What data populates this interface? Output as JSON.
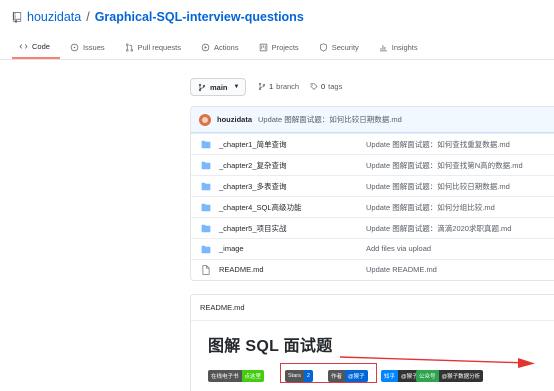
{
  "repo": {
    "owner": "houzidata",
    "separator": "/",
    "name": "Graphical-SQL-interview-questions"
  },
  "tabs": [
    {
      "label": "Code",
      "icon": "code-icon",
      "active": true
    },
    {
      "label": "Issues",
      "icon": "issue-icon",
      "active": false
    },
    {
      "label": "Pull requests",
      "icon": "pull-request-icon",
      "active": false
    },
    {
      "label": "Actions",
      "icon": "play-icon",
      "active": false
    },
    {
      "label": "Projects",
      "icon": "project-icon",
      "active": false
    },
    {
      "label": "Security",
      "icon": "shield-icon",
      "active": false
    },
    {
      "label": "Insights",
      "icon": "graph-icon",
      "active": false
    }
  ],
  "branch": {
    "selected": "main",
    "count_number": "1",
    "count_label": "branch",
    "tags_number": "0",
    "tags_label": "tags"
  },
  "commit": {
    "author": "houzidata",
    "message": "Update 图解面试题：如何比较日期数据.md"
  },
  "files": [
    {
      "name": "_chapter1_简单查询",
      "message": "Update 图解面试题：如何查找重复数据.md",
      "type": "dir"
    },
    {
      "name": "_chapter2_复杂查询",
      "message": "Update 图解面试题：如何查找第N高的数据.md",
      "type": "dir"
    },
    {
      "name": "_chapter3_多表查询",
      "message": "Update 图解面试题：如何比较日期数据.md",
      "type": "dir"
    },
    {
      "name": "_chapter4_SQL高级功能",
      "message": "Update 图解面试题：如何分组比较.md",
      "type": "dir"
    },
    {
      "name": "_chapter5_项目实战",
      "message": "Update 图解面试题：滴滴2020求职真题.md",
      "type": "dir"
    },
    {
      "name": "_image",
      "message": "Add files via upload",
      "type": "dir"
    },
    {
      "name": "README.md",
      "message": "Update README.md",
      "type": "file"
    }
  ],
  "readme": {
    "filename": "README.md",
    "title": "图解 SQL 面试题",
    "badges": [
      {
        "left": "在线电子书",
        "right": "点这里",
        "left_color": "#555555",
        "right_color": "#4c1"
      },
      {
        "left": "Stars",
        "right": "2",
        "left_color": "#555555",
        "right_color": "#0366d6"
      },
      {
        "left": "作者",
        "right": "@猴子",
        "left_color": "#555555",
        "right_color": "#0366d6"
      },
      {
        "left": "知乎",
        "right": "@猴子",
        "left_color": "#0084ff",
        "right_color": "#333333"
      },
      {
        "left": "公众号",
        "right": "@猴子数据分析",
        "left_color": "#2ea44f",
        "right_color": "#333333"
      }
    ]
  },
  "colors": {
    "link": "#0366d6",
    "folder": "#79b8ff",
    "tab_underline": "#f9826c",
    "highlight": "#d73a49",
    "arrow": "#e3342f"
  }
}
